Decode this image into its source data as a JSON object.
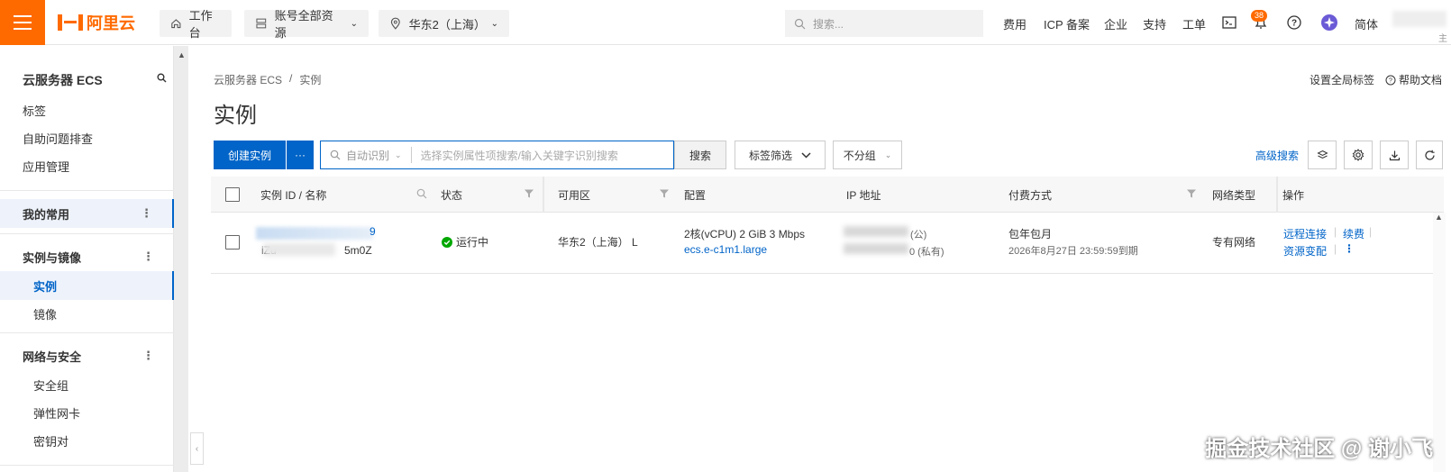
{
  "topbar": {
    "logo_text": "阿里云",
    "workbench": "工作台",
    "resources": "账号全部资源",
    "region": "华东2（上海）",
    "search_placeholder": "搜索...",
    "links": [
      "费用",
      "ICP 备案",
      "企业",
      "支持",
      "工单"
    ],
    "notification_count": "38",
    "language": "简体",
    "user_tag": "主"
  },
  "sidebar": {
    "title": "云服务器 ECS",
    "items_top": [
      "标签",
      "自助问题排查",
      "应用管理"
    ],
    "favorites": "我的常用",
    "group_instances": "实例与镜像",
    "instance_items": [
      "实例",
      "镜像"
    ],
    "group_network": "网络与安全",
    "network_items": [
      "安全组",
      "弹性网卡",
      "密钥对"
    ],
    "more_icon": "⋮"
  },
  "breadcrumb": [
    "云服务器 ECS",
    "/",
    "实例"
  ],
  "page_title": "实例",
  "header_links": {
    "global_tags": "设置全局标签",
    "help": "帮助文档"
  },
  "toolbar": {
    "create": "创建实例",
    "more": "···",
    "search_mode": "自动识别",
    "search_placeholder": "选择实例属性项搜索/输入关键字识别搜索",
    "search_btn": "搜索",
    "tag_filter": "标签筛选",
    "group": "不分组",
    "advanced": "高级搜索"
  },
  "table": {
    "headers": [
      "实例 ID / 名称",
      "状态",
      "可用区",
      "配置",
      "IP 地址",
      "付费方式",
      "网络类型",
      "操作"
    ],
    "rows": [
      {
        "id_visible": "iZu",
        "id_suffix": "5m0Z",
        "id_end": "9",
        "status": "运行中",
        "zone": "华东2（上海） L",
        "config_line1": "2核(vCPU)  2 GiB 3 Mbps",
        "config_type": "ecs.e-c1m1.large",
        "ip_public_suffix": "(公)",
        "ip_private_suffix": "0 (私有)",
        "billing": "包年包月",
        "expire": "2026年8月27日 23:59:59到期",
        "network": "专有网络",
        "actions": [
          "远程连接",
          "续费",
          "资源变配"
        ]
      }
    ]
  },
  "watermark": "掘金技术社区 @ 谢小飞",
  "colors": {
    "brand": "#ff6a00",
    "primary": "#0064c8",
    "running": "#00a700"
  }
}
